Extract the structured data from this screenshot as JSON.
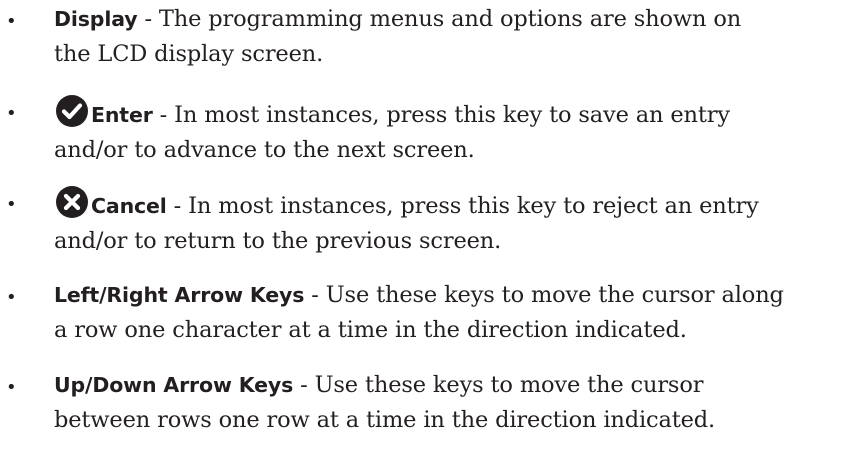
{
  "items": [
    {
      "label": "Display",
      "line1": " - The programming menus and options are shown on",
      "line2": "the LCD display screen."
    },
    {
      "icon": "check-circle-icon",
      "label": "Enter",
      "line1": " - In most instances, press this key to save an entry",
      "line2": "and/or to advance to the next screen."
    },
    {
      "icon": "x-circle-icon",
      "label": "Cancel",
      "line1": " - In most instances, press this key to reject an entry",
      "line2": "and/or to return to the previous screen."
    },
    {
      "label": "Left/Right Arrow Keys",
      "line1": " - Use these keys to move the cursor along",
      "line2": "a row one character at a time in the direction indicated."
    },
    {
      "label": "Up/Down Arrow Keys",
      "line1": " - Use these keys to move the cursor",
      "line2": "between rows one row at a time in the direction indicated."
    }
  ],
  "bullet": "•",
  "colors": {
    "text": "#231f20",
    "icon": "#231f20"
  }
}
